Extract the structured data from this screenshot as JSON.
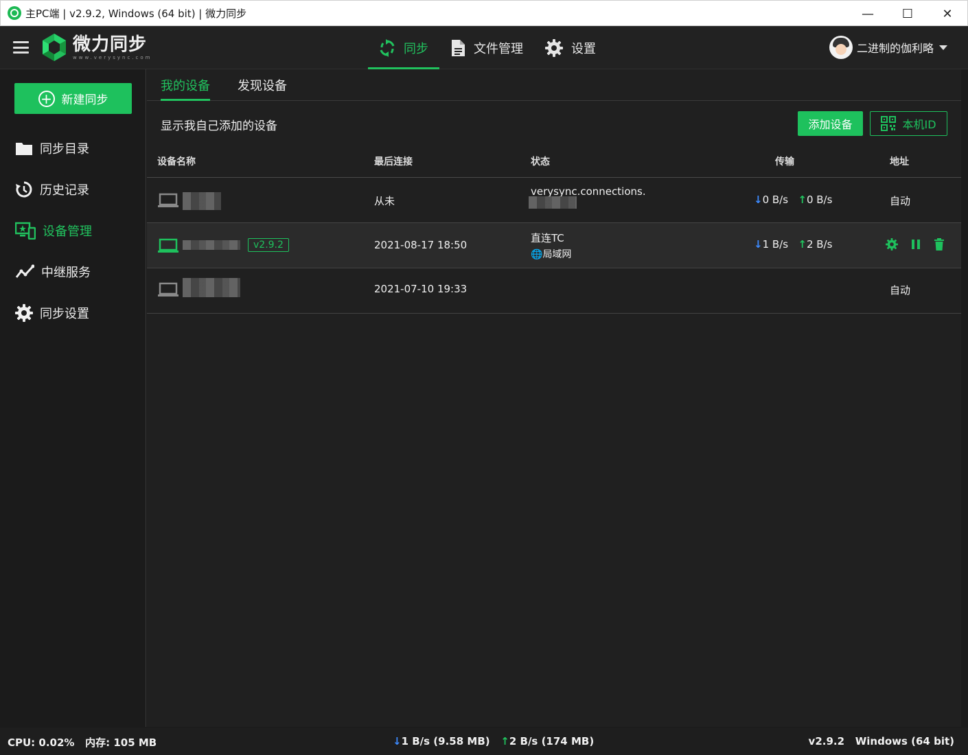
{
  "window": {
    "title": "主PC端 | v2.9.2, Windows (64 bit) | 微力同步",
    "minimize": "—",
    "maximize": "☐",
    "close": "✕"
  },
  "header": {
    "logo_cn": "微力同步",
    "logo_en": "www.verysync.com",
    "nav": [
      {
        "label": "同步",
        "icon": "sync-icon",
        "active": true
      },
      {
        "label": "文件管理",
        "icon": "file-icon",
        "active": false
      },
      {
        "label": "设置",
        "icon": "gear-icon",
        "active": false
      }
    ],
    "username": "二进制的伽利略"
  },
  "sidebar": {
    "new_sync_label": "新建同步",
    "items": [
      {
        "label": "同步目录",
        "icon": "folder-icon"
      },
      {
        "label": "历史记录",
        "icon": "history-icon"
      },
      {
        "label": "设备管理",
        "icon": "device-icon",
        "active": true
      },
      {
        "label": "中继服务",
        "icon": "relay-icon"
      },
      {
        "label": "同步设置",
        "icon": "gear-icon"
      }
    ]
  },
  "main": {
    "tabs": [
      {
        "label": "我的设备",
        "active": true
      },
      {
        "label": "发现设备",
        "active": false
      }
    ],
    "description": "显示我自己添加的设备",
    "add_device_label": "添加设备",
    "local_id_label": "本机ID",
    "columns": [
      "设备名称",
      "最后连接",
      "状态",
      "传输",
      "地址"
    ],
    "devices": [
      {
        "version": "",
        "last_connected": "从未",
        "status_line1": "verysync.connections.",
        "status_line2": "",
        "down": "0 B/s",
        "up": "0 B/s",
        "address": "自动",
        "connected": false
      },
      {
        "version": "v2.9.2",
        "last_connected": "2021-08-17 18:50",
        "status_line1": "直连TC",
        "status_line2": "局域网",
        "down": "1 B/s",
        "up": "2 B/s",
        "address": "",
        "connected": true
      },
      {
        "version": "",
        "last_connected": "2021-07-10 19:33",
        "status_line1": "",
        "status_line2": "",
        "down": "",
        "up": "",
        "address": "自动",
        "connected": false
      }
    ]
  },
  "statusbar": {
    "cpu": "CPU: 0.02%",
    "memory": "内存: 105 MB",
    "download": "1 B/s (9.58 MB)",
    "upload": "2 B/s (174 MB)",
    "version": "v2.9.2",
    "os": "Windows (64 bit)"
  },
  "colors": {
    "accent": "#1ec15d",
    "download_arrow": "#3d8bff",
    "background": "#202020"
  }
}
